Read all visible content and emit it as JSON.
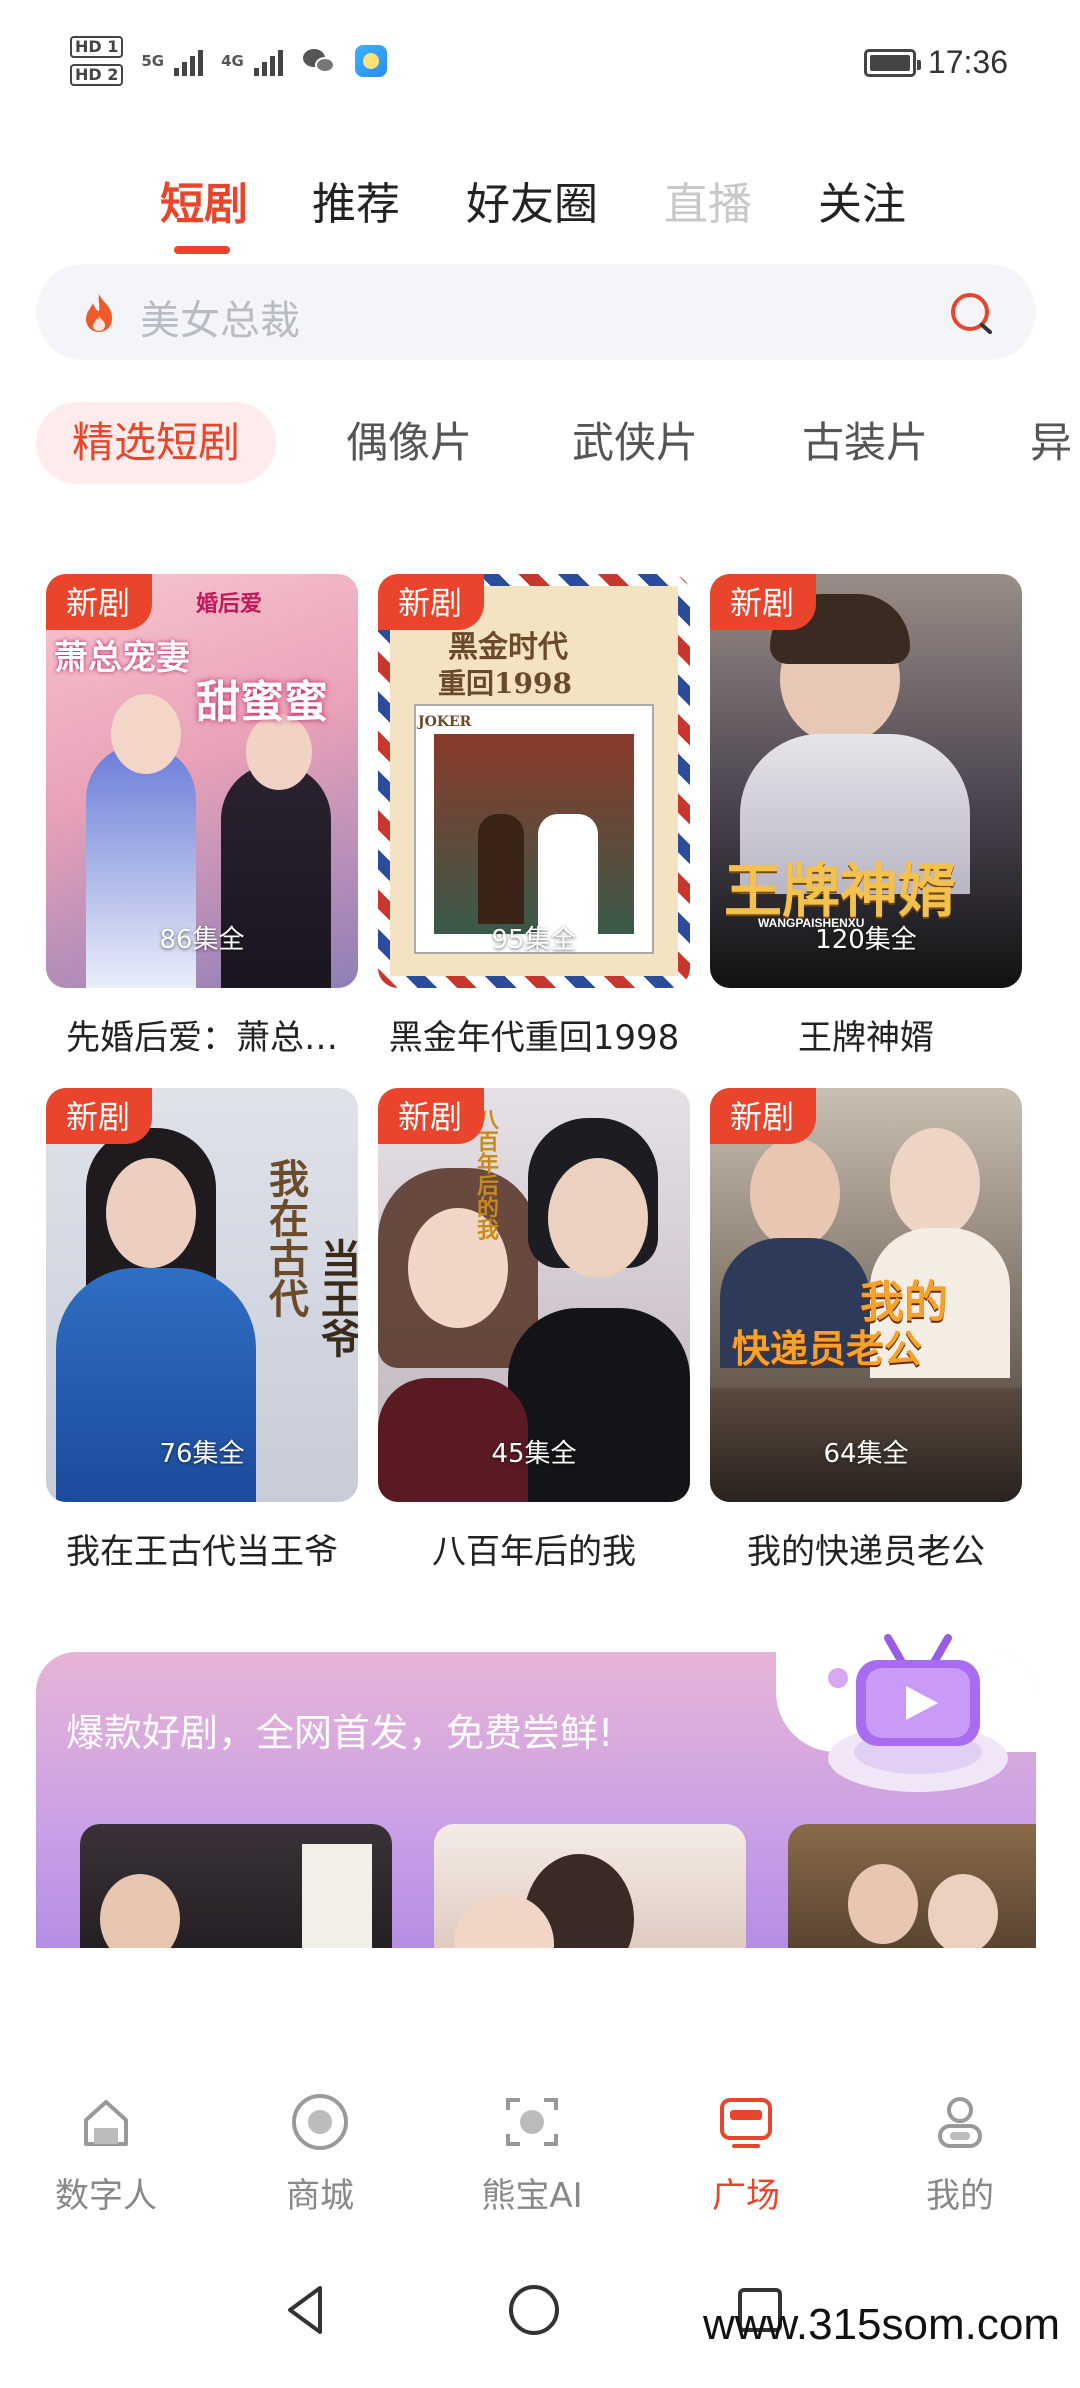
{
  "status_bar": {
    "hd1": "HD 1",
    "hd2": "HD 2",
    "net1": "5G",
    "net2": "4G",
    "time": "17:36"
  },
  "top_tabs": [
    {
      "label": "短剧",
      "active": true
    },
    {
      "label": "推荐"
    },
    {
      "label": "好友圈"
    },
    {
      "label": "直播",
      "muted": true
    },
    {
      "label": "关注"
    }
  ],
  "search": {
    "placeholder": "美女总裁",
    "icon": "fire-icon"
  },
  "categories": [
    {
      "label": "精选短剧",
      "active": true
    },
    {
      "label": "偶像片"
    },
    {
      "label": "武侠片"
    },
    {
      "label": "古装片"
    },
    {
      "label": "异"
    }
  ],
  "dramas": [
    {
      "badge": "新剧",
      "episodes": "86集全",
      "title": "先婚后爱：萧总…",
      "poster_text1": "萧总宠妻",
      "poster_text2": "甜蜜蜜",
      "poster_corner": "婚后爱"
    },
    {
      "badge": "新剧",
      "episodes": "95集全",
      "title": "黑金年代重回1998",
      "poster_text1": "黑金时代",
      "poster_text2": "重回1998",
      "poster_corner": "JOKER"
    },
    {
      "badge": "新剧",
      "episodes": "120集全",
      "title": "王牌神婿",
      "poster_text1": "王牌神婿",
      "poster_text2": "WANGPAISHENXU"
    },
    {
      "badge": "新剧",
      "episodes": "76集全",
      "title": "我在王古代当王爷",
      "poster_text1": "我在古代",
      "poster_text2": "当王爷"
    },
    {
      "badge": "新剧",
      "episodes": "45集全",
      "title": "八百年后的我",
      "poster_text1": "八百年后的我"
    },
    {
      "badge": "新剧",
      "episodes": "64集全",
      "title": "我的快递员老公",
      "poster_text1": "我的",
      "poster_text2": "快递员老公"
    }
  ],
  "promo": {
    "text": "爆款好剧，全网首发，免费尝鲜!"
  },
  "bottom_nav": [
    {
      "label": "数字人",
      "icon": "home-icon"
    },
    {
      "label": "商城",
      "icon": "mall-icon"
    },
    {
      "label": "熊宝AI",
      "icon": "ai-icon"
    },
    {
      "label": "广场",
      "icon": "tv-square-icon",
      "active": true
    },
    {
      "label": "我的",
      "icon": "profile-icon"
    }
  ],
  "watermark": "www.315som.com",
  "colors": {
    "accent": "#e8452c",
    "chip_bg": "#fdeceb",
    "search_bg": "#f3f5f8"
  }
}
